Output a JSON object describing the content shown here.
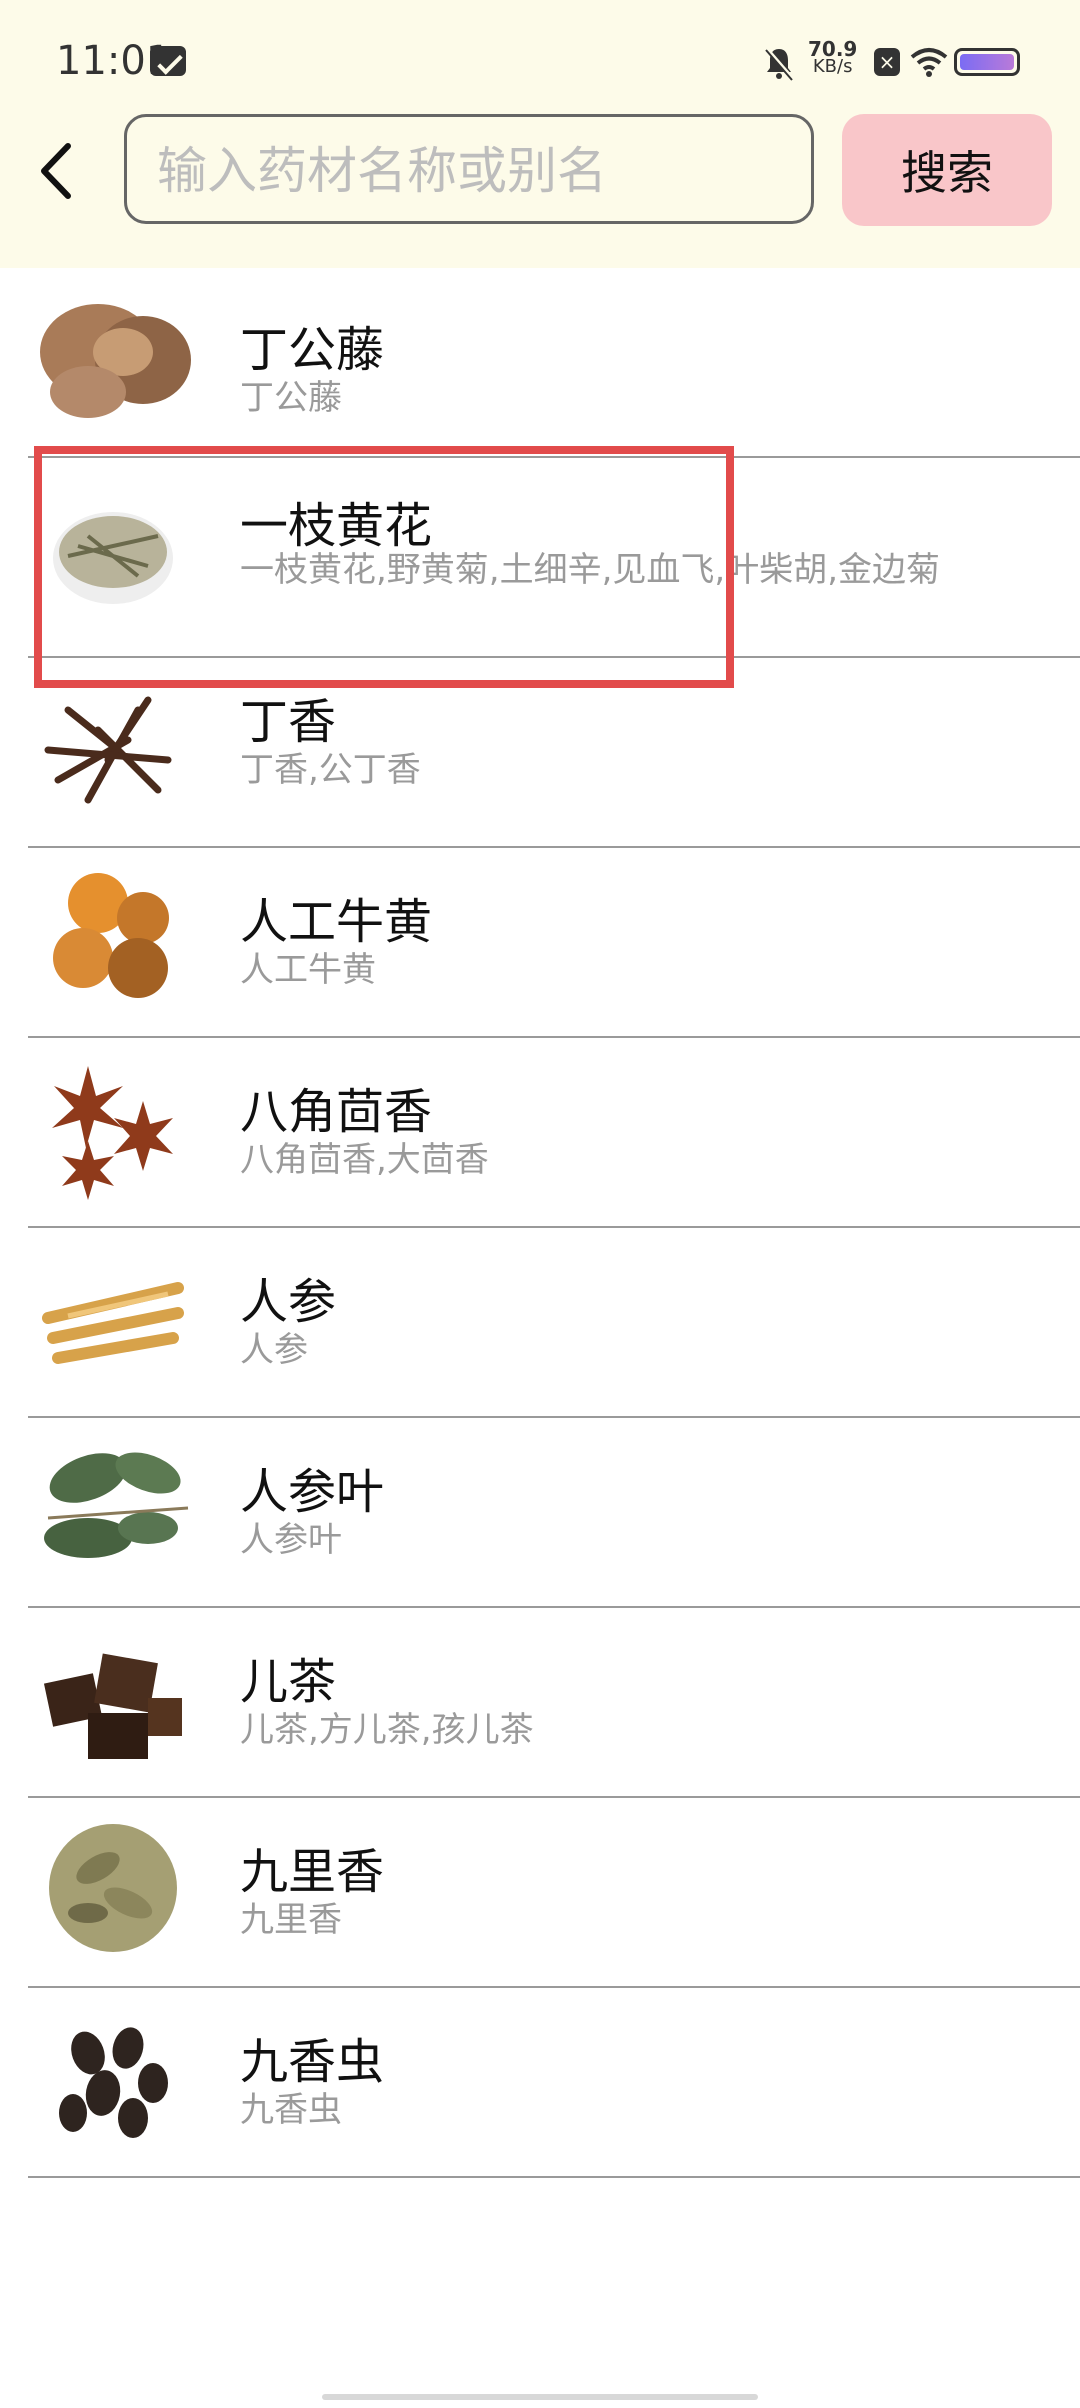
{
  "status_bar": {
    "time": "11:01",
    "net_speed_value": "70.9",
    "net_speed_unit": "KB/s"
  },
  "search": {
    "placeholder": "输入药材名称或别名",
    "value": "",
    "button_label": "搜索"
  },
  "items": [
    {
      "title": "丁公藤",
      "alias": "丁公藤"
    },
    {
      "title": "一枝黄花",
      "alias": "一枝黄花,野黄菊,土细辛,见血飞,叶柴胡,金边菊"
    },
    {
      "title": "丁香",
      "alias": "丁香,公丁香"
    },
    {
      "title": "人工牛黄",
      "alias": "人工牛黄"
    },
    {
      "title": "八角茴香",
      "alias": "八角茴香,大茴香"
    },
    {
      "title": "人参",
      "alias": "人参"
    },
    {
      "title": "人参叶",
      "alias": "人参叶"
    },
    {
      "title": "儿茶",
      "alias": "儿茶,方儿茶,孩儿茶"
    },
    {
      "title": "九里香",
      "alias": "九里香"
    },
    {
      "title": "九香虫",
      "alias": "九香虫"
    }
  ],
  "colors": {
    "header_bg": "#fdfbe9",
    "search_button_bg": "#f9c6c9",
    "highlight": "#e24b4b"
  }
}
